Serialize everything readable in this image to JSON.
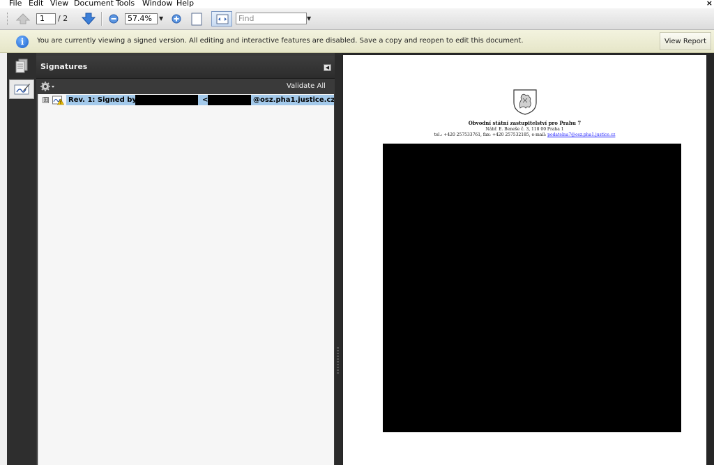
{
  "menu": {
    "items": [
      "File",
      "Edit",
      "View",
      "Document",
      "Tools",
      "Window",
      "Help"
    ],
    "close_glyph": "×"
  },
  "toolbar": {
    "prev_page_icon": "arrow-up-icon",
    "next_page_icon": "arrow-down-icon",
    "current_page": "1",
    "total_pages": "/ 2",
    "zoom_out_icon": "zoom-out-icon",
    "zoom_value": "57.4%",
    "zoom_in_icon": "zoom-in-icon",
    "fit_page_icon": "fit-page-icon",
    "fit_width_icon": "fit-width-icon",
    "find_placeholder": "Find"
  },
  "infobar": {
    "icon": "info-icon",
    "message": "You are currently viewing a signed version. All editing and interactive features are disabled. Save a copy and reopen to edit this document.",
    "view_report_label": "View Report"
  },
  "nav_rail": {
    "pages_icon": "pages-icon",
    "signatures_icon": "signature-pen-icon"
  },
  "signatures_panel": {
    "title": "Signatures",
    "options_icon": "gear-icon",
    "validate_all_label": "Validate All",
    "items": [
      {
        "expander": "⊞",
        "status_icon": "signature-warning-icon",
        "label_prefix": "Rev. 1: Signed by",
        "label_angle": "<",
        "label_domain": "@osz.pha1.justice.cz"
      }
    ]
  },
  "document": {
    "crest_icon": "coat-of-arms-icon",
    "letterhead_title": "Obvodní státní zastupitelství pro Prahu 7",
    "letterhead_address": "Nábř. E. Beneše č. 3, 118 00  Praha 1",
    "letterhead_contact": "tel.: +420 257533761, fax: +420 257532185, e-mail: ",
    "letterhead_email": "podatelna7@osz.pha1.justice.cz"
  },
  "colors": {
    "infobar_bg": "#eeeed6",
    "panel_bg": "#3a3a3a",
    "selection": "#a3c9ea",
    "link": "#1a1aff"
  }
}
